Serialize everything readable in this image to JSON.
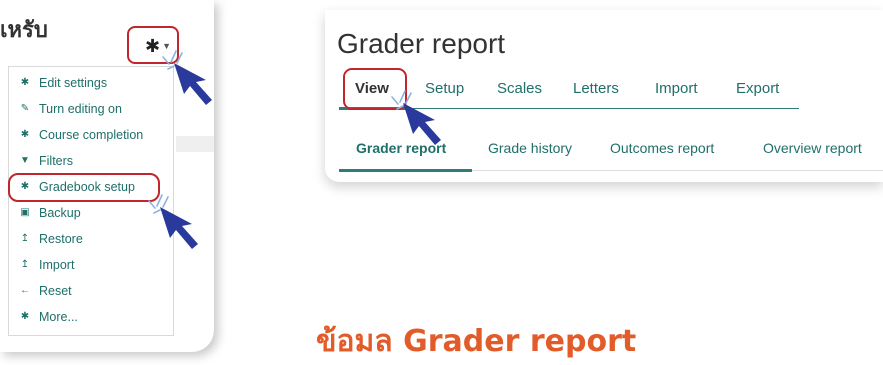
{
  "left_panel": {
    "title": "เหรับ",
    "gear_icon": "gear-icon",
    "menu_items": [
      {
        "label": "Edit settings",
        "icon": "gear-icon"
      },
      {
        "label": "Turn editing on",
        "icon": "pencil-icon"
      },
      {
        "label": "Course completion",
        "icon": "gear-icon"
      },
      {
        "label": "Filters",
        "icon": "filter-icon"
      },
      {
        "label": "Gradebook setup",
        "icon": "gear-icon"
      },
      {
        "label": "Backup",
        "icon": "save-icon"
      },
      {
        "label": "Restore",
        "icon": "upload-icon"
      },
      {
        "label": "Import",
        "icon": "upload-icon"
      },
      {
        "label": "Reset",
        "icon": "arrow-left-icon"
      },
      {
        "label": "More...",
        "icon": "gear-icon"
      }
    ]
  },
  "right_panel": {
    "title": "Grader report",
    "tabs": [
      "View",
      "Setup",
      "Scales",
      "Letters",
      "Import",
      "Export"
    ],
    "subtabs": [
      "Grader report",
      "Grade history",
      "Outcomes report",
      "Overview report"
    ]
  },
  "caption": "ข้อมล Grader report",
  "colors": {
    "highlight": "#c0262b",
    "accent": "#2f7b7a",
    "link": "#1f6f6a",
    "caption": "#e25c2a",
    "pointer": "#2a3a9c"
  }
}
